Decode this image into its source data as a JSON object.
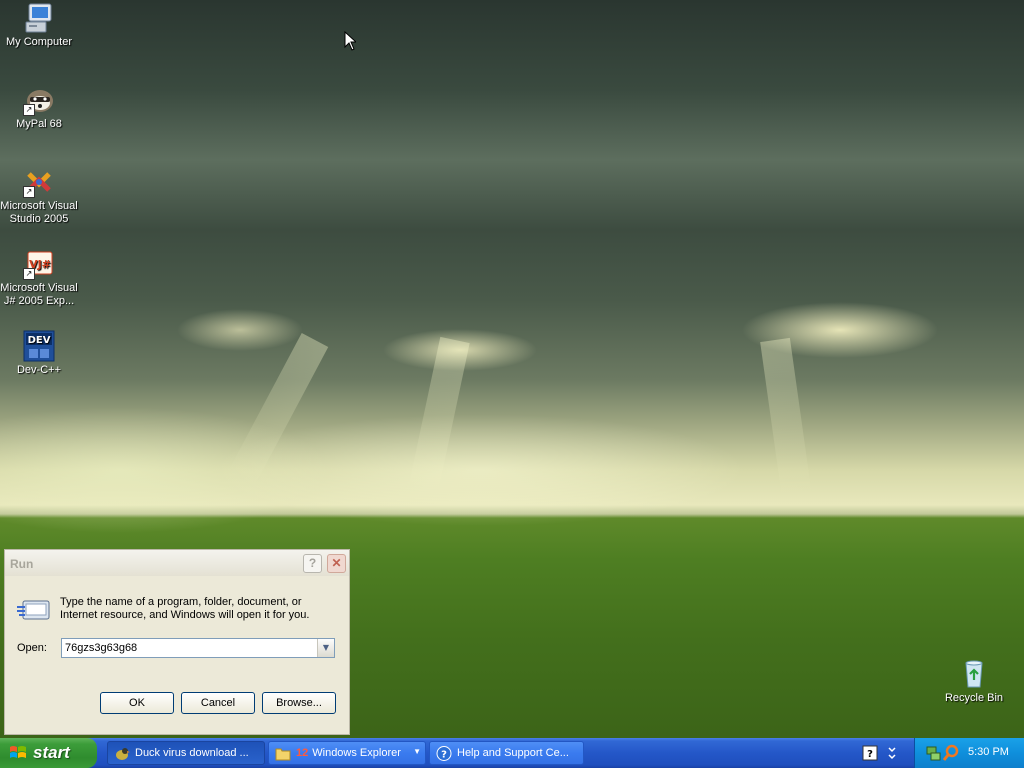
{
  "desktop_icons": [
    {
      "label": "My Computer",
      "icon": "my-computer-icon"
    },
    {
      "label": "MyPal 68",
      "icon": "mypal-raccoon-icon"
    },
    {
      "label": "Microsoft Visual Studio 2005",
      "icon": "visual-studio-icon"
    },
    {
      "label": "Microsoft Visual J# 2005 Exp...",
      "icon": "vj-sharp-icon"
    },
    {
      "label": "Dev-C++",
      "icon": "dev-cpp-icon"
    },
    {
      "label": "Recycle Bin",
      "icon": "recycle-bin-icon"
    }
  ],
  "run_dialog": {
    "title": "Run",
    "help_label": "?",
    "close_label": "✕",
    "description": "Type the name of a program, folder, document, or Internet resource, and Windows will open it for you.",
    "open_label": "Open:",
    "open_value": "76gzs3g63g68",
    "ok_label": "OK",
    "cancel_label": "Cancel",
    "browse_label": "Browse..."
  },
  "taskbar": {
    "start_label": "start",
    "tasks": [
      {
        "label": "Duck virus download ...",
        "icon": "duck-icon",
        "active": true
      },
      {
        "label": "Windows Explorer",
        "count": "12",
        "icon": "folder-icon",
        "active": false
      },
      {
        "label": "Help and Support Ce...",
        "icon": "help-icon",
        "active": false
      }
    ],
    "clock": "5:30 PM"
  },
  "colors": {
    "taskbar_blue": "#2457c8",
    "start_green": "#3c9d3a",
    "dialog_face": "#ece9d8",
    "tray_blue": "#0f8fdc"
  }
}
